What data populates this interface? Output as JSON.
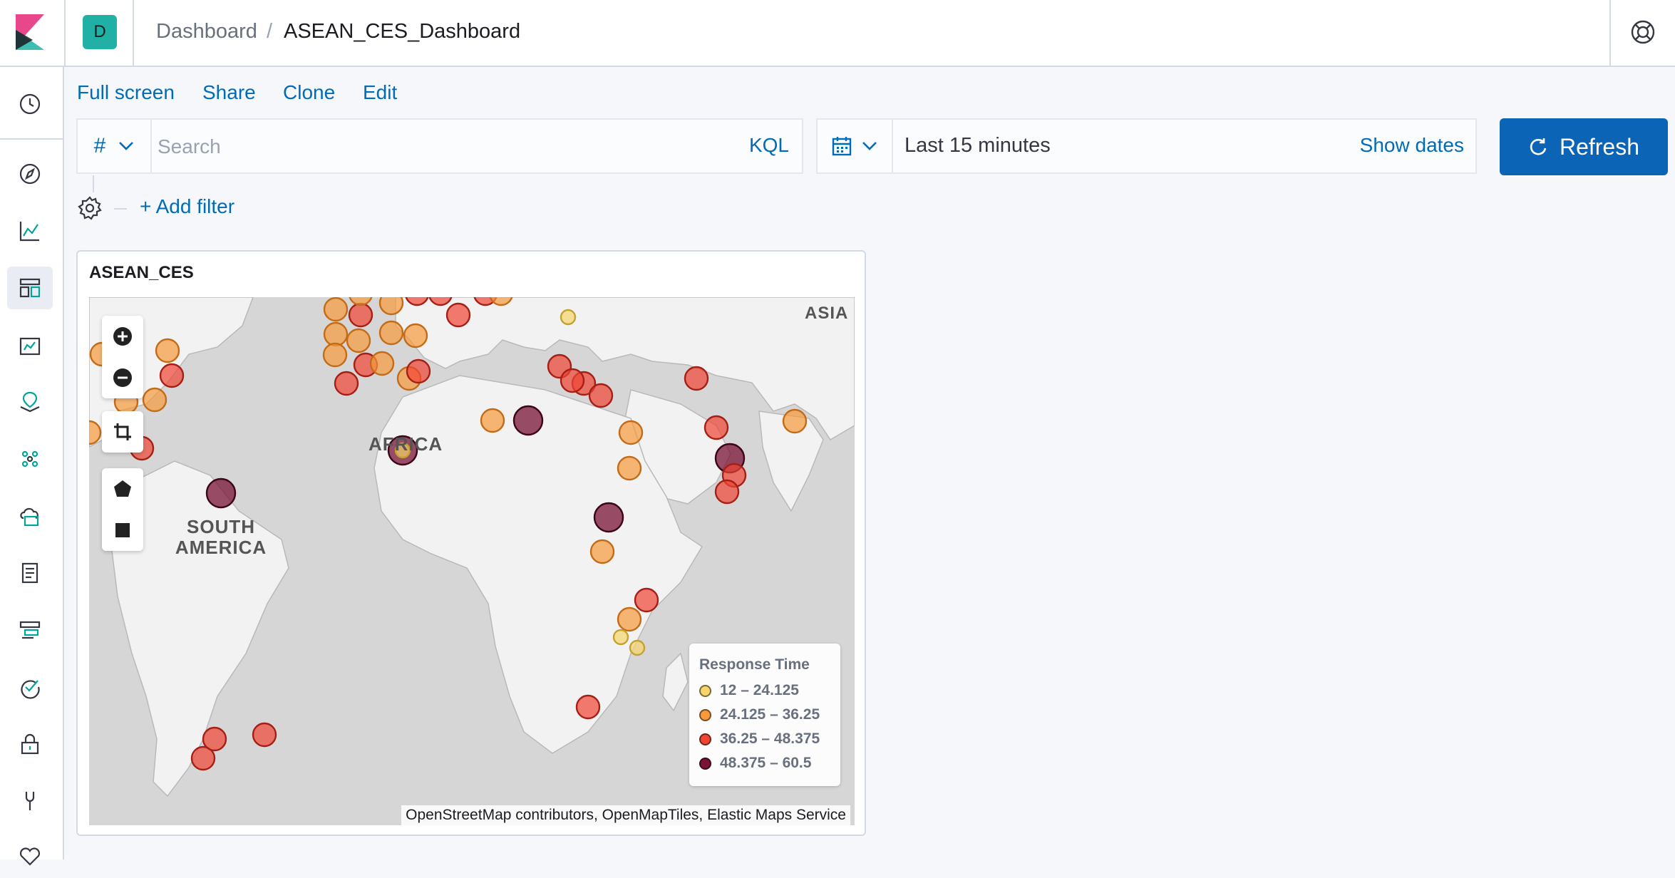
{
  "header": {
    "space_initial": "D",
    "breadcrumbs": [
      "Dashboard",
      "ASEAN_CES_Dashboard"
    ],
    "separator": "/"
  },
  "sidenav": {
    "items": [
      "clock-icon",
      "compass-icon",
      "visualize-icon",
      "dashboard-icon",
      "canvas-icon",
      "maps-icon",
      "ml-icon",
      "infrastructure-icon",
      "logs-icon",
      "apm-icon",
      "uptime-icon",
      "siem-icon",
      "dev-tools-icon",
      "monitoring-icon"
    ]
  },
  "toolbar": {
    "full_screen": "Full screen",
    "share": "Share",
    "clone": "Clone",
    "edit": "Edit"
  },
  "query": {
    "lang_symbol": "#",
    "placeholder": "Search",
    "kql": "KQL"
  },
  "date": {
    "range": "Last 15 minutes",
    "show_dates": "Show dates"
  },
  "refresh_label": "Refresh",
  "filter": {
    "add_filter": "+ Add filter"
  },
  "panel": {
    "title": "ASEAN_CES",
    "map_labels": {
      "asia": "ASIA",
      "africa": "AFRICA",
      "south_america": "SOUTH AMERICA"
    },
    "legend": {
      "title": "Response Time",
      "items": [
        {
          "label": "12 – 24.125",
          "color": "#f7d56b"
        },
        {
          "label": "24.125 – 36.25",
          "color": "#f79a3c"
        },
        {
          "label": "36.25 – 48.375",
          "color": "#ef4433"
        },
        {
          "label": "48.375 – 60.5",
          "color": "#7a1335"
        }
      ]
    },
    "attribution": "OpenStreetMap contributors, OpenMapTiles, Elastic Maps Service"
  },
  "colors": {
    "accent": "#006bb8",
    "primary_button": "#0b64b5",
    "space_avatar": "#20b1a4"
  }
}
